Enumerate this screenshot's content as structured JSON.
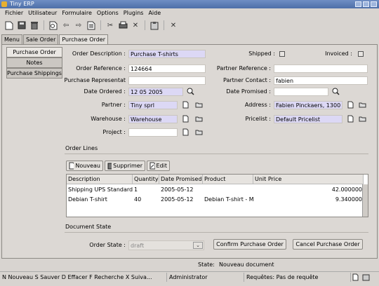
{
  "window": {
    "title": "Tiny ERP"
  },
  "menu": [
    "Fichier",
    "Utilisateur",
    "Formulaire",
    "Options",
    "Plugins",
    "Aide"
  ],
  "toolbar": {
    "icons": [
      "new-icon",
      "save-icon",
      "delete-icon",
      "search-icon",
      "previous-icon",
      "next-icon",
      "list-icon",
      "attach-icon",
      "print-icon",
      "tools-icon",
      "clipboard-icon",
      "close-icon"
    ]
  },
  "tabs": [
    "Menu",
    "Sale Order",
    "Purchase Order"
  ],
  "side_tabs": [
    "Purchase Order",
    "Notes",
    "Purchase Shippings"
  ],
  "form": {
    "order_description_label": "Order Description :",
    "order_description": "Purchase T-shirts",
    "shipped_label": "Shipped :",
    "invoiced_label": "Invoiced :",
    "order_reference_label": "Order Reference :",
    "order_reference": "124664",
    "partner_reference_label": "Partner Reference :",
    "partner_reference": "",
    "purchase_rep_label": "Purchase Representat",
    "purchase_rep": "",
    "partner_contact_label": "Partner Contact :",
    "partner_contact": "fabien",
    "date_ordered_label": "Date Ordered :",
    "date_ordered": "12 05 2005",
    "date_promised_label": "Date Promised :",
    "date_promised": "",
    "partner_label": "Partner :",
    "partner": "Tiny sprl",
    "address_label": "Address :",
    "address": "Fabien Pinckaers, 1300 L",
    "warehouse_label": "Warehouse :",
    "warehouse": "Warehouse",
    "pricelist_label": "Pricelist :",
    "pricelist": "Default Pricelist",
    "project_label": "Project :",
    "project": ""
  },
  "order_lines": {
    "title": "Order Lines",
    "buttons": {
      "new": "Nouveau",
      "delete": "Supprimer",
      "edit": "Edit"
    },
    "columns": [
      "Description",
      "Quantity",
      "Date Promised",
      "Product",
      "Unit Price"
    ],
    "rows": [
      [
        "Shipping UPS Standard",
        "1",
        "2005-05-12",
        "",
        "42.000000"
      ],
      [
        "Debian T-shirt",
        "40",
        "2005-05-12",
        "Debian T-shirt - M",
        "9.340000"
      ]
    ]
  },
  "document_state": {
    "title": "Document State",
    "order_state_label": "Order State :",
    "order_state": "draft",
    "confirm_button": "Confirm Purchase Order",
    "cancel_button": "Cancel Purchase Order"
  },
  "state": {
    "label": "State:",
    "value": "Nouveau document"
  },
  "statusbar": {
    "shortcuts": "N Nouveau   S Sauver   D Effacer   F Recherche   X Suiva...",
    "user": "Administrator",
    "requests_label": "Requêtes:",
    "requests": "Pas de requête"
  }
}
